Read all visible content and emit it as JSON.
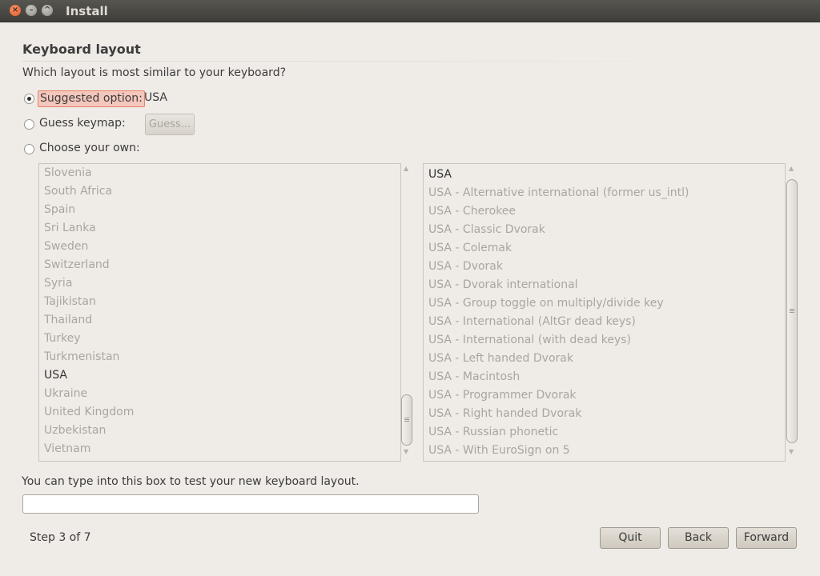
{
  "window": {
    "title": "Install"
  },
  "page": {
    "heading": "Keyboard layout",
    "question": "Which layout is most similar to your keyboard?"
  },
  "options": {
    "suggested_label": "Suggested option:",
    "suggested_value": "USA",
    "guess_label": "Guess keymap:",
    "guess_button": "Guess...",
    "choose_label": "Choose your own:"
  },
  "countries": [
    "Slovenia",
    "South Africa",
    "Spain",
    "Sri Lanka",
    "Sweden",
    "Switzerland",
    "Syria",
    "Tajikistan",
    "Thailand",
    "Turkey",
    "Turkmenistan",
    "USA",
    "Ukraine",
    "United Kingdom",
    "Uzbekistan",
    "Vietnam"
  ],
  "selected_country": "USA",
  "variants": [
    "USA",
    "USA - Alternative international (former us_intl)",
    "USA - Cherokee",
    "USA - Classic Dvorak",
    "USA - Colemak",
    "USA - Dvorak",
    "USA - Dvorak international",
    "USA - Group toggle on multiply/divide key",
    "USA - International (AltGr dead keys)",
    "USA - International (with dead keys)",
    "USA - Left handed Dvorak",
    "USA - Macintosh",
    "USA - Programmer Dvorak",
    "USA - Right handed Dvorak",
    "USA - Russian phonetic",
    "USA - With EuroSign on 5"
  ],
  "selected_variant": "USA",
  "test": {
    "label": "You can type into this box to test your new keyboard layout.",
    "value": ""
  },
  "footer": {
    "step": "Step 3 of 7",
    "quit": "Quit",
    "back": "Back",
    "forward": "Forward"
  }
}
